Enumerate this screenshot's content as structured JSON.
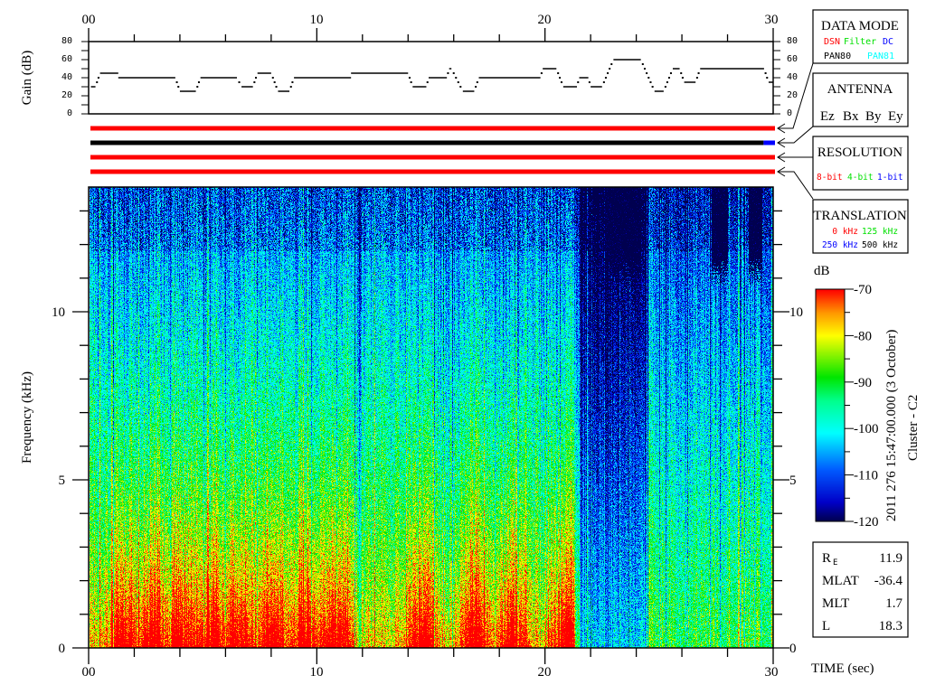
{
  "colors": {
    "red": "#ff0000",
    "green": "#00e000",
    "blue": "#0000ff",
    "cyan": "#00ffff",
    "black": "#000000"
  },
  "time_axis": {
    "ticks": [
      "00",
      "10",
      "20",
      "30"
    ],
    "label": "TIME (sec)"
  },
  "gain_panel": {
    "ylabel": "Gain (dB)",
    "ticks": [
      "80",
      "60",
      "40",
      "20",
      "0"
    ]
  },
  "data_mode": {
    "title": "DATA MODE",
    "options": [
      "DSN",
      "Filter",
      "DC",
      "PAN80",
      "PAN81"
    ]
  },
  "antenna": {
    "title": "ANTENNA",
    "options": [
      "Ez",
      "Bx",
      "By",
      "Ey"
    ]
  },
  "resolution": {
    "title": "RESOLUTION",
    "options": [
      "8-bit",
      "4-bit",
      "1-bit"
    ]
  },
  "translation": {
    "title": "TRANSLATION",
    "options": [
      "0 kHz",
      "125 kHz",
      "250 kHz",
      "500 kHz"
    ]
  },
  "spectrogram": {
    "ylabel": "Frequency (kHz)",
    "yticks": [
      "0",
      "5",
      "10"
    ]
  },
  "colorbar": {
    "unit": "dB",
    "ticks": [
      "-70",
      "-80",
      "-90",
      "-100",
      "-110",
      "-120"
    ]
  },
  "caption": {
    "datetime": "2011 276 15:47:00.000 (3 October)",
    "spacecraft": "Cluster - C2"
  },
  "stats": [
    {
      "label": "R",
      "sub": "E",
      "value": "11.9"
    },
    {
      "label": "MLAT",
      "sub": "",
      "value": "-36.4"
    },
    {
      "label": "MLT",
      "sub": "",
      "value": "1.7"
    },
    {
      "label": "L",
      "sub": "",
      "value": "18.3"
    }
  ],
  "chart_data": [
    {
      "type": "line",
      "title": "Gain",
      "xlabel": "TIME (sec)",
      "ylabel": "Gain (dB)",
      "xlim": [
        0,
        30
      ],
      "ylim": [
        0,
        80
      ],
      "steps": [
        [
          0.1,
          0.3,
          30
        ],
        [
          0.5,
          1.3,
          45
        ],
        [
          1.3,
          3.8,
          40
        ],
        [
          4.0,
          4.7,
          25
        ],
        [
          4.9,
          6.5,
          40
        ],
        [
          6.7,
          7.2,
          30
        ],
        [
          7.4,
          8.0,
          45
        ],
        [
          8.3,
          8.8,
          25
        ],
        [
          9.0,
          11.5,
          40
        ],
        [
          11.5,
          14.0,
          45
        ],
        [
          14.2,
          14.8,
          30
        ],
        [
          14.9,
          15.7,
          40
        ],
        [
          15.8,
          15.9,
          50
        ],
        [
          16.4,
          16.9,
          25
        ],
        [
          17.1,
          19.8,
          40
        ],
        [
          19.9,
          20.5,
          50
        ],
        [
          20.8,
          21.4,
          30
        ],
        [
          21.5,
          21.9,
          40
        ],
        [
          22.0,
          22.5,
          30
        ],
        [
          23.0,
          24.2,
          60
        ],
        [
          24.8,
          25.2,
          25
        ],
        [
          25.6,
          25.9,
          50
        ],
        [
          26.1,
          26.6,
          35
        ],
        [
          26.8,
          29.6,
          50
        ],
        [
          29.8,
          30.0,
          35
        ]
      ]
    },
    {
      "type": "status_bars",
      "rows": [
        {
          "name": "data_mode",
          "segments": [
            [
              0,
              30,
              "DSN"
            ]
          ]
        },
        {
          "name": "antenna",
          "segments": [
            [
              0,
              29.5,
              "Ey"
            ],
            [
              29.5,
              30,
              "By"
            ]
          ]
        },
        {
          "name": "resolution",
          "segments": [
            [
              0,
              30,
              "8-bit"
            ]
          ]
        },
        {
          "name": "translation",
          "segments": [
            [
              0,
              30,
              "0 kHz"
            ]
          ]
        }
      ]
    },
    {
      "type": "heatmap",
      "xlabel": "TIME (sec)",
      "ylabel": "Frequency (kHz)",
      "xlim": [
        0,
        30
      ],
      "ylim": [
        0,
        13.7
      ],
      "zlim": [
        -120,
        -70
      ],
      "zlabel": "dB",
      "intense_low_freq_bursts_sec": [
        1.5,
        2.7,
        4.0,
        5.3,
        6.4,
        8.0,
        9.5,
        10.8,
        14.6,
        16.9,
        18.5,
        20.9
      ],
      "quiet_interval_sec": [
        21.5,
        24.5
      ],
      "dark_upper_band_intervals_sec": [
        [
          22.6,
          24.2
        ],
        [
          27.3,
          28.0
        ],
        [
          28.9,
          29.5
        ]
      ]
    }
  ]
}
